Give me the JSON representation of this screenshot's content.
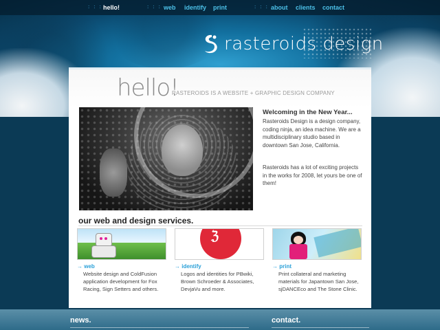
{
  "nav": {
    "separator": ": : :",
    "items": [
      {
        "label": "hello!",
        "active": true
      },
      {
        "label": "web",
        "active": false
      },
      {
        "label": "identify",
        "active": false
      },
      {
        "label": "print",
        "active": false
      },
      {
        "label": "about",
        "active": false
      },
      {
        "label": "clients",
        "active": false
      },
      {
        "label": "contact",
        "active": false
      }
    ]
  },
  "logo": {
    "text": "rasteroids design",
    "icon": "swirl-logo-icon"
  },
  "intro": {
    "hello": "hello!",
    "tagline": "RASTEROIDS IS A WEBSITE + GRAPHIC DESIGN COMPANY"
  },
  "welcome": {
    "title": "Welcoming in the New Year...",
    "paragraph1": "Rasteroids Design is a design company, coding ninja, an idea machine. We are a multidisciplinary studio based in downtown San Jose, California.",
    "paragraph2": "Rasteroids has a lot of exciting projects in the works for 2008, let yours be one of them!"
  },
  "services": {
    "heading": "our web and design services.",
    "arrow": "→",
    "items": [
      {
        "label": "web",
        "description": "Website design and ColdFusion application development for Fox Racing, Sign Setters and others."
      },
      {
        "label": "identify",
        "description": "Logos and identities for PBwiki, Brown Schroeder & Associates, DevjaVu and more."
      },
      {
        "label": "print",
        "description": "Print collateral and marketing materials for Japantown San Jose, sjDANCEco and The Stone Clinic."
      }
    ]
  },
  "footer": {
    "news": "news.",
    "contact": "contact."
  },
  "colors": {
    "accent": "#2aa0d8",
    "nav_link": "#4cc0e8",
    "footer": "#4a7f99"
  }
}
